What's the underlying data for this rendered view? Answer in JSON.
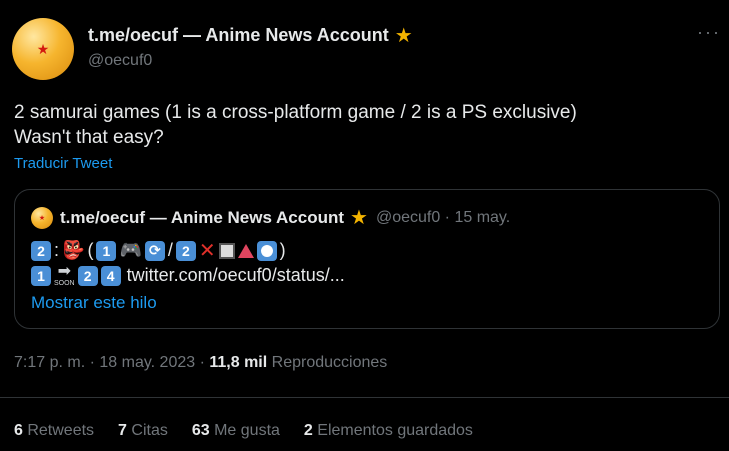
{
  "tweet": {
    "author_name": "t.me/oecuf — Anime News Account",
    "handle": "@oecuf0",
    "text": "2 samurai games (1 is a cross-platform game / 2 is a PS exclusive)\nWasn't that easy?",
    "translate_label": "Traducir Tweet",
    "more_label": "···",
    "timestamp": "7:17 p. m. · 18 may. 2023 · ",
    "views_count": "11,8 mil",
    "views_label": " Reproducciones"
  },
  "quote": {
    "author_name": "t.me/oecuf — Anime News Account",
    "handle_date": "@oecuf0 · 15 may.",
    "paren_open": "(",
    "slash": "/",
    "paren_close": ")",
    "colon": ":",
    "keycap_2": "2",
    "keycap_1": "1",
    "keycap_4": "4",
    "soon_label": "SOON",
    "link_text": "twitter.com/oecuf0/status/...",
    "show_thread_label": "Mostrar este hilo"
  },
  "stats": {
    "retweets_count": "6",
    "retweets_label": " Retweets",
    "quotes_count": "7",
    "quotes_label": " Citas",
    "likes_count": "63",
    "likes_label": " Me gusta",
    "bookmarks_count": "2",
    "bookmarks_label": " Elementos guardados"
  },
  "icons": {
    "verified": "star-badge-icon",
    "avatar": "dragon-ball-icon"
  },
  "colors": {
    "background": "#000000",
    "link": "#1d9bf0",
    "muted": "#71767b",
    "text": "#e7e9ea",
    "badge": "#f4b400"
  }
}
